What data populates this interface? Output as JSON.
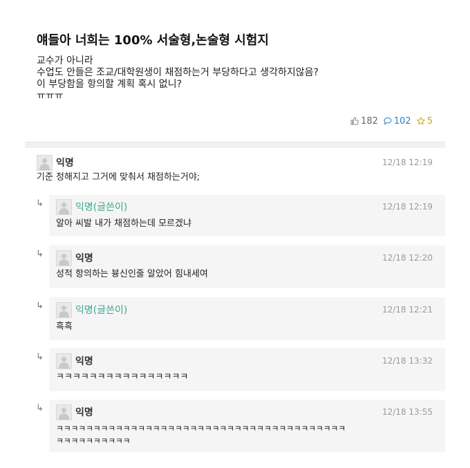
{
  "post": {
    "title": "얘들아 너희는 100% 서술형,논술형 시험지",
    "body_lines": [
      "교수가 아니라",
      "수업도 안들은 조교/대학원생이 채점하는거 부당하다고 생각하지않음?",
      "이 부당함을 항의할 계획 혹시 없니?",
      "ㅠㅠㅠ"
    ],
    "likes": "182",
    "comments": "102",
    "scraps": "5"
  },
  "comments": [
    {
      "author": "익명",
      "time": "12/18 12:19",
      "text": "기준 정해지고 그거에 맞춰서 채점하는거야;",
      "reply": false,
      "op": false
    },
    {
      "author": "익명(글쓴이)",
      "time": "12/18 12:19",
      "text": "알아 씨발 내가 채점하는데 모르겠냐",
      "reply": true,
      "op": true
    },
    {
      "author": "익명",
      "time": "12/18 12:20",
      "text": "성적 항의하는 븅신인줄 알았어 힘내세여",
      "reply": true,
      "op": false
    },
    {
      "author": "익명(글쓴이)",
      "time": "12/18 12:21",
      "text": "흑흑",
      "reply": true,
      "op": true
    },
    {
      "author": "익명",
      "time": "12/18 13:32",
      "text": "ㅋㅋㅋㅋㅋㅋㅋㅋㅋㅋㅋㅋㅋㅋㅋㅋ",
      "reply": true,
      "op": false
    },
    {
      "author": "익명",
      "time": "12/18 13:55",
      "text_lines": [
        "ㅋㅋㅋㅋㅋㅋㅋㅋㅋㅋㅋㅋㅋㅋㅋㅋㅋㅋㅋㅋㅋㅋㅋㅋㅋㅋㅋㅋㅋㅋㅋㅋㅋㅋㅋㅋㅋㅋㅋ",
        "ㅋㅋㅋㅋㅋㅋㅋㅋㅋㅋ"
      ],
      "reply": true,
      "op": false
    }
  ],
  "icons": {
    "like": "thumbs-up-icon",
    "comment": "comment-bubble-icon",
    "scrap": "star-icon",
    "reply": "reply-arrow-icon",
    "avatar": "anonymous-avatar-icon"
  },
  "colors": {
    "op_author": "#3aa68f",
    "comment_count": "#2b7fc4",
    "scrap_count": "#d4a017",
    "reply_bg": "#f5f5f5"
  }
}
